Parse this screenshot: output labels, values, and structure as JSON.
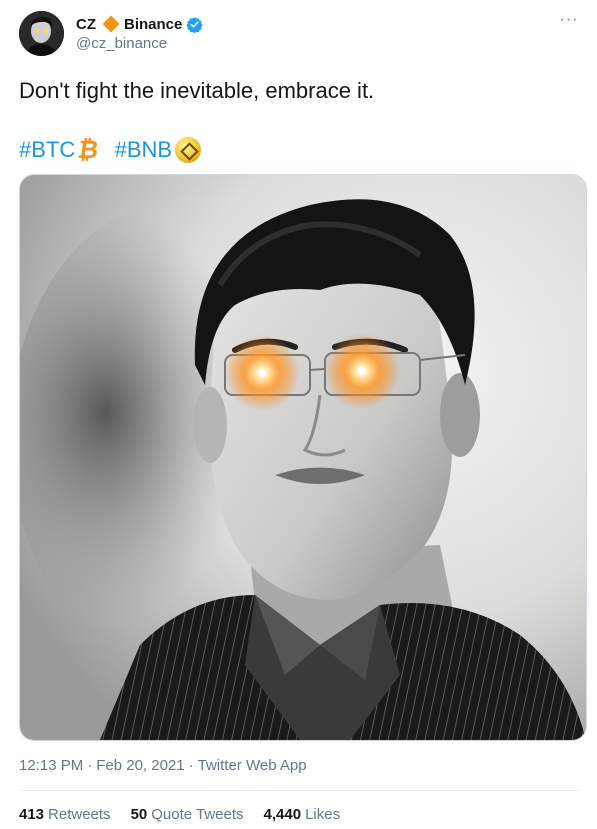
{
  "author": {
    "name": "CZ",
    "affiliation": "Binance",
    "handle": "@cz_binance",
    "diamond_icon": "orange-diamond-icon",
    "verified_icon": "verified-badge-icon"
  },
  "tweet": {
    "text": "Don't fight the inevitable, embrace it.",
    "hashtags": [
      {
        "tag": "#BTC",
        "emoji": "bitcoin-emoji-icon"
      },
      {
        "tag": "#BNB",
        "emoji": "bnb-coin-emoji-icon"
      }
    ],
    "more_icon": "more-options-icon"
  },
  "meta": {
    "time": "12:13 PM",
    "separator": "·",
    "date": "Feb 20, 2021",
    "app": "Twitter Web App"
  },
  "stats": {
    "retweets": {
      "count": "413",
      "label": "Retweets"
    },
    "quotes": {
      "count": "50",
      "label": "Quote Tweets"
    },
    "likes": {
      "count": "4,440",
      "label": "Likes"
    }
  },
  "colors": {
    "link": "#1b95e0",
    "secondary": "#657786",
    "accent_diamond": "#f3961c",
    "verified": "#1da1f2",
    "laser_glow": "#ffa733"
  }
}
